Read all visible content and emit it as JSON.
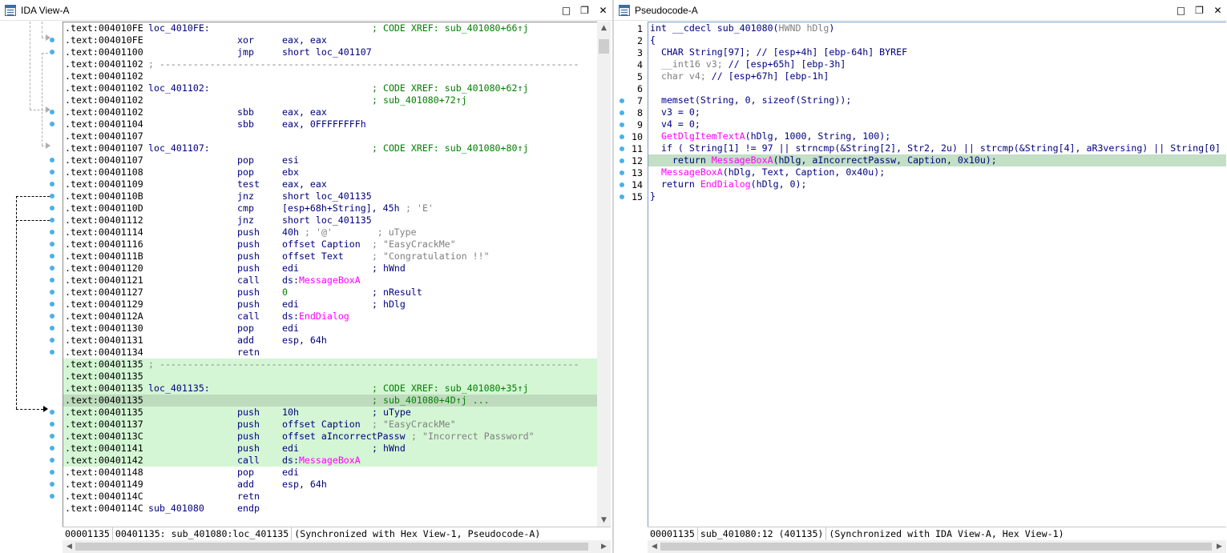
{
  "left": {
    "title": "IDA View-A",
    "status": [
      "00001135",
      "00401135: sub_401080:loc_401135",
      "(Synchronized with Hex View-1, Pseudocode-A)"
    ],
    "lines": [
      {
        "addr": ".text:004010FE",
        "label": "loc_4010FE:",
        "mn": "",
        "op": "",
        "cm": "; CODE XREF: sub_401080+66↑j",
        "cmc": "g",
        "hl": ""
      },
      {
        "addr": ".text:004010FE",
        "label": "",
        "mn": "xor",
        "op": "eax, eax",
        "cm": "",
        "hl": ""
      },
      {
        "addr": ".text:00401100",
        "label": "",
        "mn": "jmp",
        "op": "short loc_401107",
        "cm": "",
        "hl": ""
      },
      {
        "addr": ".text:00401102",
        "label": "",
        "mn": "",
        "op": "",
        "cm": "; ---------------------------------------------------------------------------",
        "cmc": "gr",
        "hl": ""
      },
      {
        "addr": ".text:00401102",
        "label": "",
        "mn": "",
        "op": "",
        "cm": "",
        "hl": ""
      },
      {
        "addr": ".text:00401102",
        "label": "loc_401102:",
        "mn": "",
        "op": "",
        "cm": "; CODE XREF: sub_401080+62↑j",
        "cmc": "g",
        "hl": ""
      },
      {
        "addr": ".text:00401102",
        "label": "",
        "mn": "",
        "op": "",
        "cm": "; sub_401080+72↑j",
        "cmc": "g",
        "hl": ""
      },
      {
        "addr": ".text:00401102",
        "label": "",
        "mn": "sbb",
        "op": "eax, eax",
        "cm": "",
        "hl": ""
      },
      {
        "addr": ".text:00401104",
        "label": "",
        "mn": "sbb",
        "op": "eax, 0FFFFFFFFh",
        "cm": "",
        "hl": ""
      },
      {
        "addr": ".text:00401107",
        "label": "",
        "mn": "",
        "op": "",
        "cm": "",
        "hl": ""
      },
      {
        "addr": ".text:00401107",
        "label": "loc_401107:",
        "mn": "",
        "op": "",
        "cm": "; CODE XREF: sub_401080+80↑j",
        "cmc": "g",
        "hl": ""
      },
      {
        "addr": ".text:00401107",
        "label": "",
        "mn": "pop",
        "op": "esi",
        "cm": "",
        "hl": ""
      },
      {
        "addr": ".text:00401108",
        "label": "",
        "mn": "pop",
        "op": "ebx",
        "cm": "",
        "hl": ""
      },
      {
        "addr": ".text:00401109",
        "label": "",
        "mn": "test",
        "op": "eax, eax",
        "cm": "",
        "hl": ""
      },
      {
        "addr": ".text:0040110B",
        "label": "",
        "mn": "jnz",
        "op": "short loc_401135",
        "cm": "",
        "hl": ""
      },
      {
        "addr": ".text:0040110D",
        "label": "",
        "mn": "cmp",
        "op": "[esp+68h+String], 45h",
        "cm": "; 'E'",
        "cmc": "gr",
        "hl": ""
      },
      {
        "addr": ".text:00401112",
        "label": "",
        "mn": "jnz",
        "op": "short loc_401135",
        "cm": "",
        "hl": ""
      },
      {
        "addr": ".text:00401114",
        "label": "",
        "mn": "push",
        "op": "40h",
        "cm": "; '@'        ; uType",
        "cmc": "gr",
        "hl": ""
      },
      {
        "addr": ".text:00401116",
        "label": "",
        "mn": "push",
        "op": "offset Caption",
        "cm": "; \"EasyCrackMe\"",
        "cmc": "gr",
        "hl": ""
      },
      {
        "addr": ".text:0040111B",
        "label": "",
        "mn": "push",
        "op": "offset Text",
        "cm": "; \"Congratulation !!\"",
        "cmc": "gr",
        "hl": ""
      },
      {
        "addr": ".text:00401120",
        "label": "",
        "mn": "push",
        "op": "edi",
        "cm": "; hWnd",
        "cmc": "p",
        "hl": ""
      },
      {
        "addr": ".text:00401121",
        "label": "",
        "mn": "call",
        "op": "ds:",
        "opf": "MessageBoxA",
        "cm": "",
        "hl": ""
      },
      {
        "addr": ".text:00401127",
        "label": "",
        "mn": "push",
        "op": "0",
        "opg": true,
        "cm": "; nResult",
        "cmc": "p",
        "hl": ""
      },
      {
        "addr": ".text:00401129",
        "label": "",
        "mn": "push",
        "op": "edi",
        "cm": "; hDlg",
        "cmc": "p",
        "hl": ""
      },
      {
        "addr": ".text:0040112A",
        "label": "",
        "mn": "call",
        "op": "ds:",
        "opf": "EndDialog",
        "cm": "",
        "hl": ""
      },
      {
        "addr": ".text:00401130",
        "label": "",
        "mn": "pop",
        "op": "edi",
        "cm": "",
        "hl": ""
      },
      {
        "addr": ".text:00401131",
        "label": "",
        "mn": "add",
        "op": "esp, 64h",
        "cm": "",
        "hl": ""
      },
      {
        "addr": ".text:00401134",
        "label": "",
        "mn": "retn",
        "op": "",
        "cm": "",
        "hl": ""
      },
      {
        "addr": ".text:00401135",
        "label": "",
        "mn": "",
        "op": "",
        "cm": "; ---------------------------------------------------------------------------",
        "cmc": "gr",
        "hl": "green"
      },
      {
        "addr": ".text:00401135",
        "label": "",
        "mn": "",
        "op": "",
        "cm": "",
        "hl": "green"
      },
      {
        "addr": ".text:00401135",
        "label": "loc_401135:",
        "mn": "",
        "op": "",
        "cm": "; CODE XREF: sub_401080+35↑j",
        "cmc": "g",
        "hl": "green"
      },
      {
        "addr": ".text:00401135",
        "label": "",
        "mn": "",
        "op": "",
        "cm": "; sub_401080+4D↑j ...",
        "cmc": "g",
        "hl": "green cur"
      },
      {
        "addr": ".text:00401135",
        "label": "",
        "mn": "push",
        "op": "10h",
        "cm": "; uType",
        "cmc": "p",
        "hl": "green"
      },
      {
        "addr": ".text:00401137",
        "label": "",
        "mn": "push",
        "op": "offset Caption",
        "cm": "; \"EasyCrackMe\"",
        "cmc": "gr",
        "hl": "green"
      },
      {
        "addr": ".text:0040113C",
        "label": "",
        "mn": "push",
        "op": "offset aIncorrectPassw",
        "cm": "; \"Incorrect Password\"",
        "cmc": "gr",
        "hl": "green"
      },
      {
        "addr": ".text:00401141",
        "label": "",
        "mn": "push",
        "op": "edi",
        "cm": "; hWnd",
        "cmc": "p",
        "hl": "green"
      },
      {
        "addr": ".text:00401142",
        "label": "",
        "mn": "call",
        "op": "ds:",
        "opf": "MessageBoxA",
        "cm": "",
        "hl": "green"
      },
      {
        "addr": ".text:00401148",
        "label": "",
        "mn": "pop",
        "op": "edi",
        "cm": "",
        "hl": ""
      },
      {
        "addr": ".text:00401149",
        "label": "",
        "mn": "add",
        "op": "esp, 64h",
        "cm": "",
        "hl": ""
      },
      {
        "addr": ".text:0040114C",
        "label": "",
        "mn": "retn",
        "op": "",
        "cm": "",
        "hl": ""
      },
      {
        "addr": ".text:0040114C",
        "label": "sub_401080",
        "mn": "endp",
        "op": "",
        "cm": "",
        "hl": ""
      }
    ]
  },
  "right": {
    "title": "Pseudocode-A",
    "status": [
      "00001135",
      "sub_401080:12 (401135)",
      "(Synchronized with IDA View-A, Hex View-1)"
    ],
    "lines": [
      {
        "n": "1",
        "dot": false,
        "hl": false,
        "segs": [
          [
            "k",
            "int __cdecl sub_401080("
          ],
          [
            "gr",
            "HWND hDlg"
          ],
          [
            "k",
            ")"
          ]
        ]
      },
      {
        "n": "2",
        "dot": false,
        "hl": false,
        "segs": [
          [
            "k",
            "{"
          ]
        ]
      },
      {
        "n": "3",
        "dot": false,
        "hl": false,
        "segs": [
          [
            "k",
            "  CHAR String[97]; "
          ],
          [
            "m",
            "// [esp+4h] [ebp-64h] BYREF"
          ]
        ]
      },
      {
        "n": "4",
        "dot": false,
        "hl": false,
        "segs": [
          [
            "gr",
            "  __int16 v3; "
          ],
          [
            "m",
            "// [esp+65h] [ebp-3h]"
          ]
        ]
      },
      {
        "n": "5",
        "dot": false,
        "hl": false,
        "segs": [
          [
            "gr",
            "  char v4; "
          ],
          [
            "m",
            "// [esp+67h] [ebp-1h]"
          ]
        ]
      },
      {
        "n": "6",
        "dot": false,
        "hl": false,
        "segs": [
          [
            "k",
            ""
          ]
        ]
      },
      {
        "n": "7",
        "dot": true,
        "hl": false,
        "segs": [
          [
            "k",
            "  memset("
          ],
          [
            "m",
            "String"
          ],
          [
            "k",
            ", 0, sizeof("
          ],
          [
            "m",
            "String"
          ],
          [
            "k",
            "));"
          ]
        ]
      },
      {
        "n": "8",
        "dot": true,
        "hl": false,
        "segs": [
          [
            "m",
            "  v3"
          ],
          [
            "k",
            " = 0;"
          ]
        ]
      },
      {
        "n": "9",
        "dot": true,
        "hl": false,
        "segs": [
          [
            "m",
            "  v4"
          ],
          [
            "k",
            " = 0;"
          ]
        ]
      },
      {
        "n": "10",
        "dot": true,
        "hl": false,
        "segs": [
          [
            "f",
            "  GetDlgItemTextA"
          ],
          [
            "k",
            "("
          ],
          [
            "m",
            "hDlg"
          ],
          [
            "k",
            ", 1000, "
          ],
          [
            "m",
            "String"
          ],
          [
            "k",
            ", 100);"
          ]
        ]
      },
      {
        "n": "11",
        "dot": true,
        "hl": false,
        "segs": [
          [
            "k",
            "  if ( "
          ],
          [
            "m",
            "String"
          ],
          [
            "k",
            "[1] != 97 || strncmp(&"
          ],
          [
            "m",
            "String"
          ],
          [
            "k",
            "[2], Str2, 2u) || strcmp(&"
          ],
          [
            "m",
            "String"
          ],
          [
            "k",
            "[4], aR3versing) || "
          ],
          [
            "m",
            "String"
          ],
          [
            "k",
            "[0]"
          ]
        ]
      },
      {
        "n": "12",
        "dot": true,
        "hl": true,
        "segs": [
          [
            "k",
            "    return "
          ],
          [
            "f",
            "MessageBoxA"
          ],
          [
            "k",
            "("
          ],
          [
            "m",
            "hDlg"
          ],
          [
            "k",
            ", aIncorrectPassw, Caption, 0x10u);"
          ]
        ]
      },
      {
        "n": "13",
        "dot": true,
        "hl": false,
        "segs": [
          [
            "f",
            "  MessageBoxA"
          ],
          [
            "k",
            "("
          ],
          [
            "m",
            "hDlg"
          ],
          [
            "k",
            ", Text, Caption, 0x40u);"
          ]
        ]
      },
      {
        "n": "14",
        "dot": true,
        "hl": false,
        "segs": [
          [
            "k",
            "  return "
          ],
          [
            "f",
            "EndDialog"
          ],
          [
            "k",
            "("
          ],
          [
            "m",
            "hDlg"
          ],
          [
            "k",
            ", 0);"
          ]
        ]
      },
      {
        "n": "15",
        "dot": true,
        "hl": false,
        "segs": [
          [
            "k",
            "}"
          ]
        ]
      }
    ]
  },
  "colors": {
    "green_bg": "#d4f6d4",
    "current_line": "#bedbbd",
    "code_xref": "#008000",
    "func_pink": "#ff00ff",
    "dot_blue": "#4ab0e8"
  }
}
